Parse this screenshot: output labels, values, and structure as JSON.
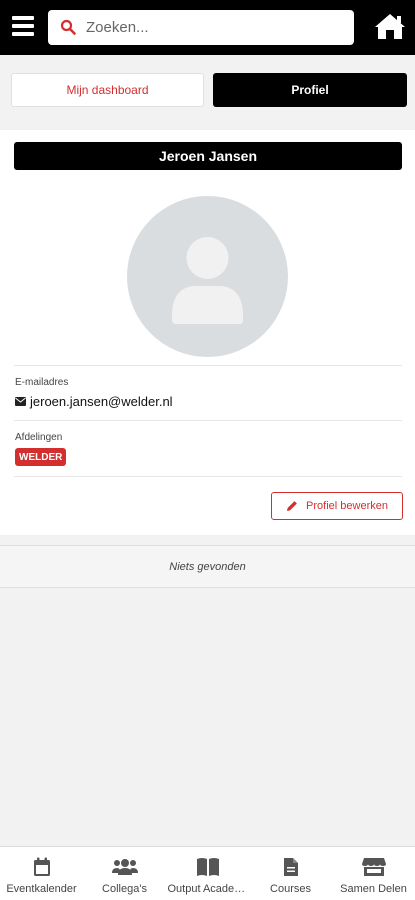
{
  "header": {
    "search_placeholder": "Zoeken...",
    "accent_color": "#d32f2f"
  },
  "tabs": [
    {
      "label": "Mijn dashboard",
      "active": false
    },
    {
      "label": "Profiel",
      "active": true
    }
  ],
  "profile": {
    "name": "Jeroen Jansen",
    "email_label": "E-mailadres",
    "email": "jeroen.jansen@welder.nl",
    "departments_label": "Afdelingen",
    "departments": [
      "WELDER"
    ],
    "edit_label": "Profiel bewerken"
  },
  "empty_message": "Niets gevonden",
  "bottom_nav": [
    {
      "label": "Eventkalender",
      "icon": "calendar-icon"
    },
    {
      "label": "Collega's",
      "icon": "users-icon"
    },
    {
      "label": "Output Academy",
      "icon": "book-icon"
    },
    {
      "label": "Courses",
      "icon": "document-icon"
    },
    {
      "label": "Samen Delen",
      "icon": "store-icon"
    }
  ]
}
